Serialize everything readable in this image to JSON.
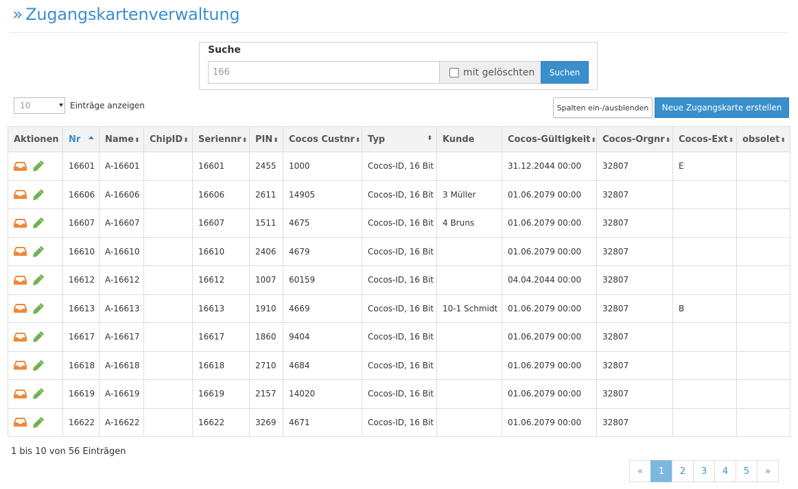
{
  "header": {
    "chevron": "»",
    "title": "Zugangskartenverwaltung"
  },
  "search": {
    "label": "Suche",
    "value": "166",
    "with_deleted_label": "mit gelöschten",
    "with_deleted_checked": false,
    "button": "Suchen"
  },
  "length": {
    "value": "10",
    "label": "Einträge anzeigen"
  },
  "buttons": {
    "columns": "Spalten ein-/ausblenden",
    "new_card": "Neue Zugangskarte erstellen"
  },
  "table": {
    "headers": [
      "Aktionen",
      "Nr",
      "Name",
      "ChipID",
      "Seriennr",
      "PIN",
      "Cocos Custnr",
      "Typ",
      "Kunde",
      "Cocos-Gültigkeit",
      "Cocos-Orgnr",
      "Cocos-Ext",
      "obsolet"
    ],
    "sort_glyph": "⬍",
    "rows": [
      [
        "16601",
        "A-16601",
        "",
        "16601",
        "2455",
        "1000",
        "Cocos-ID, 16 Bit",
        "",
        "31.12.2044 00:00",
        "32807",
        "E",
        ""
      ],
      [
        "16606",
        "A-16606",
        "",
        "16606",
        "2611",
        "14905",
        "Cocos-ID, 16 Bit",
        "3 Müller",
        "01.06.2079 00:00",
        "32807",
        "",
        ""
      ],
      [
        "16607",
        "A-16607",
        "",
        "16607",
        "1511",
        "4675",
        "Cocos-ID, 16 Bit",
        "4 Bruns",
        "01.06.2079 00:00",
        "32807",
        "",
        ""
      ],
      [
        "16610",
        "A-16610",
        "",
        "16610",
        "2406",
        "4679",
        "Cocos-ID, 16 Bit",
        "",
        "01.06.2079 00:00",
        "32807",
        "",
        ""
      ],
      [
        "16612",
        "A-16612",
        "",
        "16612",
        "1007",
        "60159",
        "Cocos-ID, 16 Bit",
        "",
        "04.04.2044 00:00",
        "32807",
        "",
        ""
      ],
      [
        "16613",
        "A-16613",
        "",
        "16613",
        "1910",
        "4669",
        "Cocos-ID, 16 Bit",
        "10-1 Schmidt",
        "01.06.2079 00:00",
        "32807",
        "B",
        ""
      ],
      [
        "16617",
        "A-16617",
        "",
        "16617",
        "1860",
        "9404",
        "Cocos-ID, 16 Bit",
        "",
        "01.06.2079 00:00",
        "32807",
        "",
        ""
      ],
      [
        "16618",
        "A-16618",
        "",
        "16618",
        "2710",
        "4684",
        "Cocos-ID, 16 Bit",
        "",
        "01.06.2079 00:00",
        "32807",
        "",
        ""
      ],
      [
        "16619",
        "A-16619",
        "",
        "16619",
        "2157",
        "14020",
        "Cocos-ID, 16 Bit",
        "",
        "01.06.2079 00:00",
        "32807",
        "",
        ""
      ],
      [
        "16622",
        "A-16622",
        "",
        "16622",
        "3269",
        "4671",
        "Cocos-ID, 16 Bit",
        "",
        "01.06.2079 00:00",
        "32807",
        "",
        ""
      ]
    ],
    "row_action_icons": [
      "inbox-tray-icon",
      "pencil-icon"
    ]
  },
  "info": "1 bis 10 von 56 Einträgen",
  "pagination": {
    "prev": "«",
    "pages": [
      "1",
      "2",
      "3",
      "4",
      "5"
    ],
    "active": "1",
    "next": "»"
  },
  "colors": {
    "accent": "#3a8fcb",
    "tray": "#f0883a",
    "pencil": "#6fb24e",
    "active_page": "#7db7dd"
  }
}
